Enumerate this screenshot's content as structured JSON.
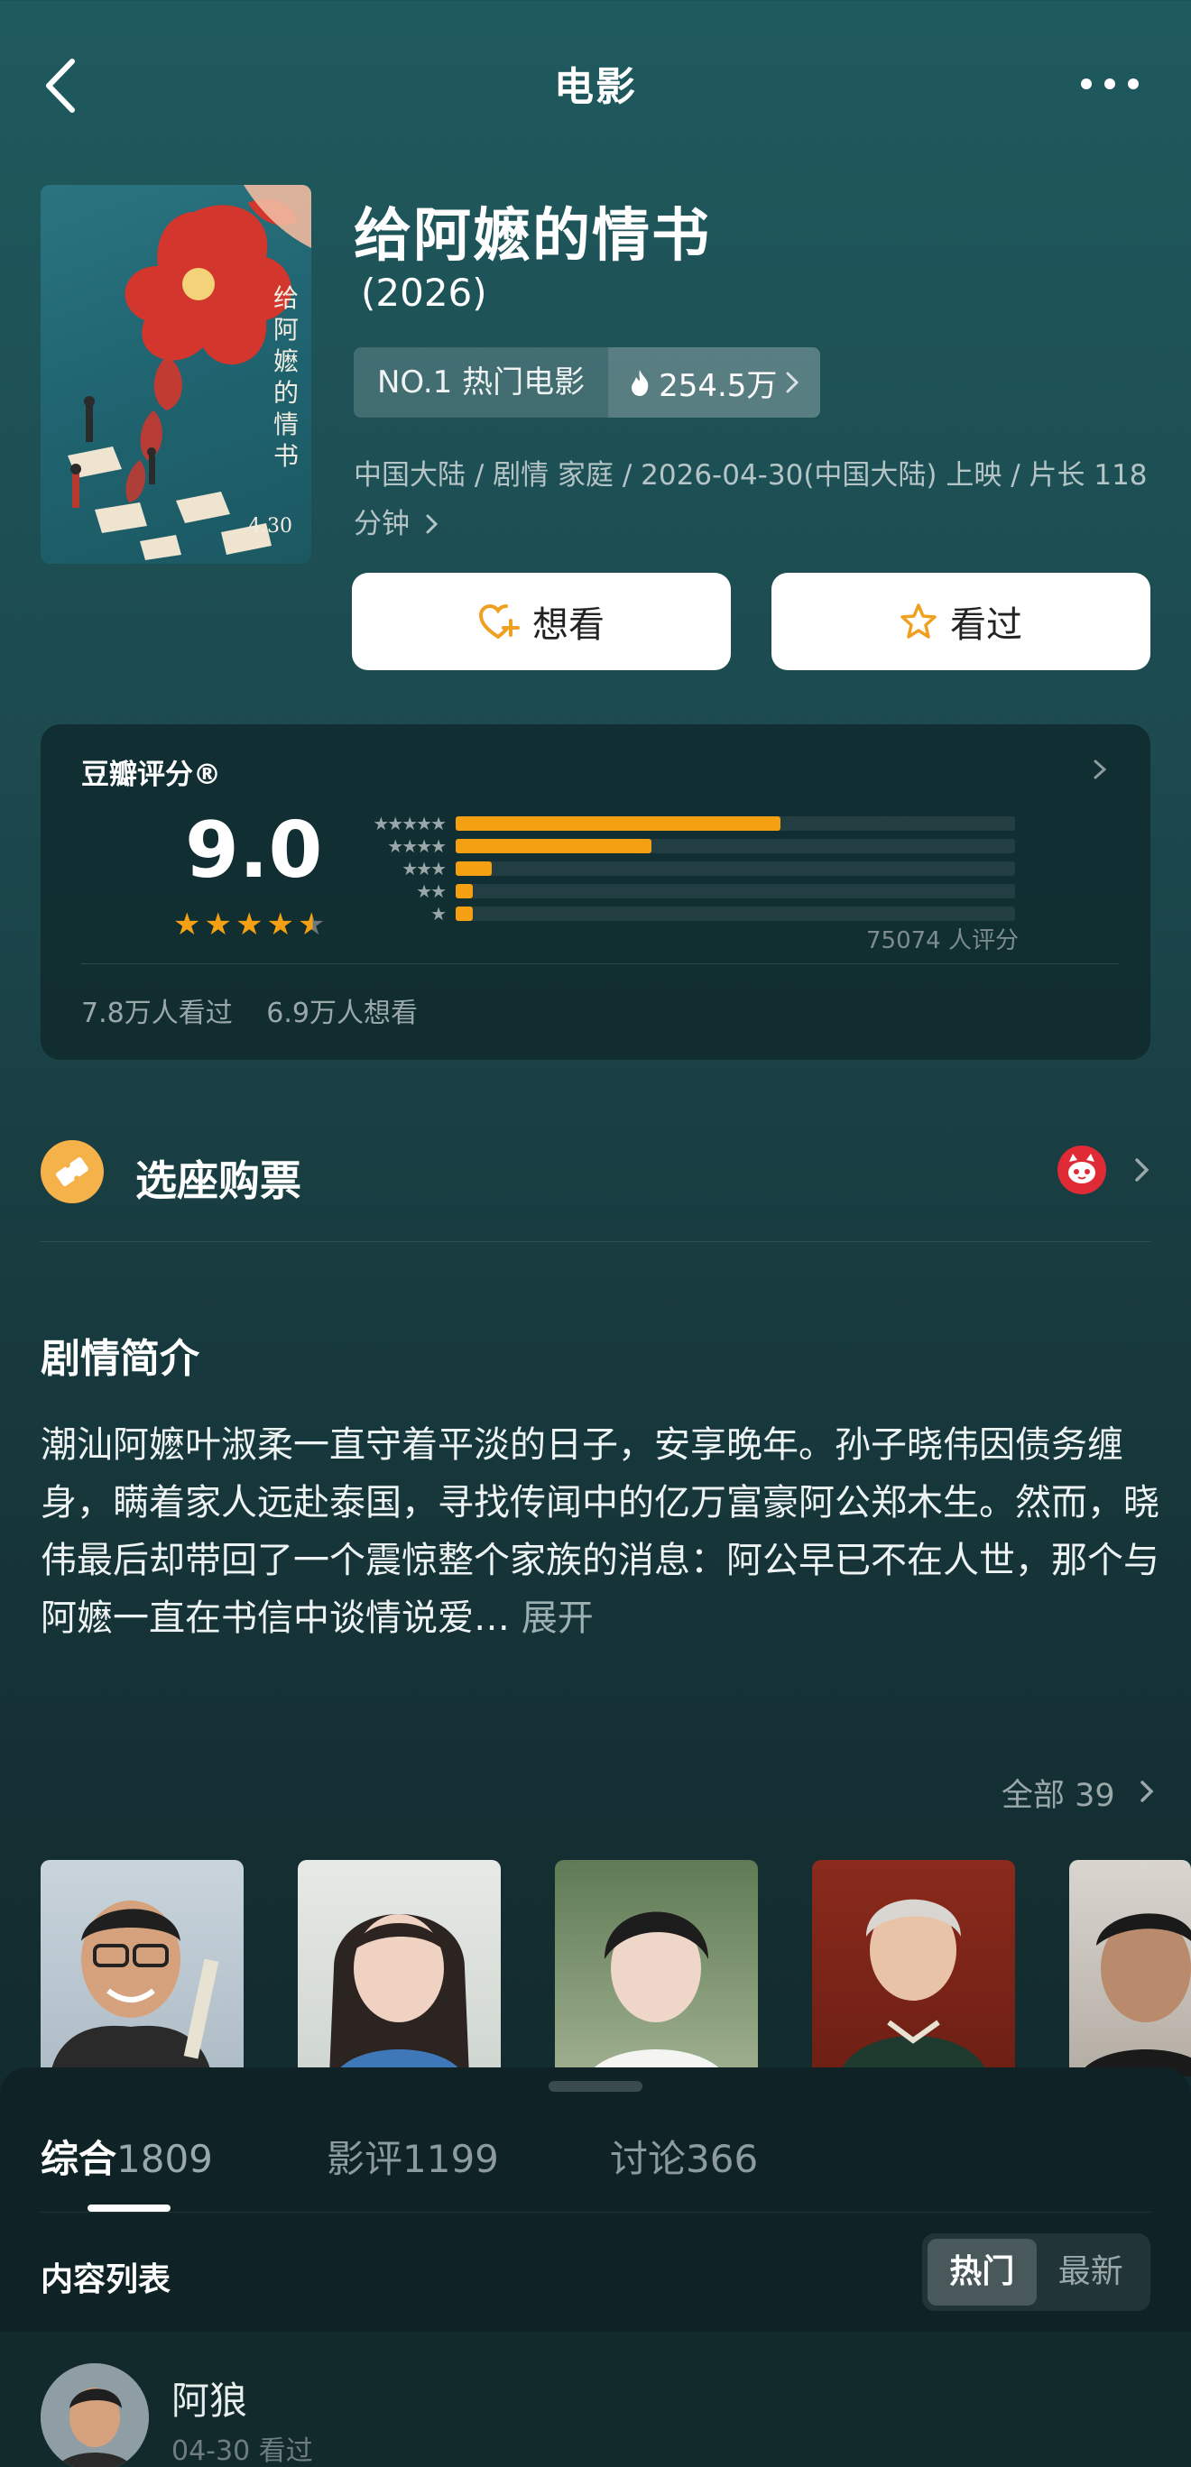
{
  "header": {
    "title": "电影"
  },
  "movie": {
    "title": "给阿嬷的情书",
    "year": "(2026)",
    "rank_label": "NO.1 热门电影",
    "heat": "254.5万",
    "meta_line": "中国大陆 / 剧情 家庭 / 2026-04-30(中国大陆) 上映 / 片长 118 分钟",
    "poster_title_text": "给阿嬷的情书",
    "poster_date_text": "4.30"
  },
  "actions": {
    "want": "想看",
    "seen": "看过"
  },
  "rating": {
    "label": "豆瓣评分®",
    "score": "9.0",
    "stars_filled": 4.5,
    "distribution": [
      {
        "stars": "★★★★★",
        "fraction": 0.58
      },
      {
        "stars": "★★★★",
        "fraction": 0.35
      },
      {
        "stars": "★★★",
        "fraction": 0.065
      },
      {
        "stars": "★★",
        "fraction": 0.03
      },
      {
        "stars": "★",
        "fraction": 0.03
      }
    ],
    "count": "75074 人评分",
    "watched": "7.8万人看过",
    "wish": "6.9万人想看",
    "colors": {
      "bar": "#f5a012",
      "star": "#f5a012"
    }
  },
  "ticket": {
    "label": "选座购票"
  },
  "synopsis": {
    "title": "剧情简介",
    "text": "潮汕阿嬷叶淑柔一直守着平淡的日子，安享晚年。孙子晓伟因债务缠身，瞒着家人远赴泰国，寻找传闻中的亿万富豪阿公郑木生。然而，晓伟最后却带回了一个震惊整个家族的消息：阿公早已不在人世，那个与阿嬷一直在书信中谈情说爱…",
    "more": "展开"
  },
  "cast": {
    "all_label": "全部 39"
  },
  "tabs": [
    {
      "label": "综合",
      "count": "1809"
    },
    {
      "label": "影评",
      "count": "1199"
    },
    {
      "label": "讨论",
      "count": "366"
    }
  ],
  "list": {
    "label": "内容列表",
    "sort": [
      "热门",
      "最新"
    ]
  },
  "post": {
    "user": "阿狼",
    "meta": "04-30 看过"
  }
}
